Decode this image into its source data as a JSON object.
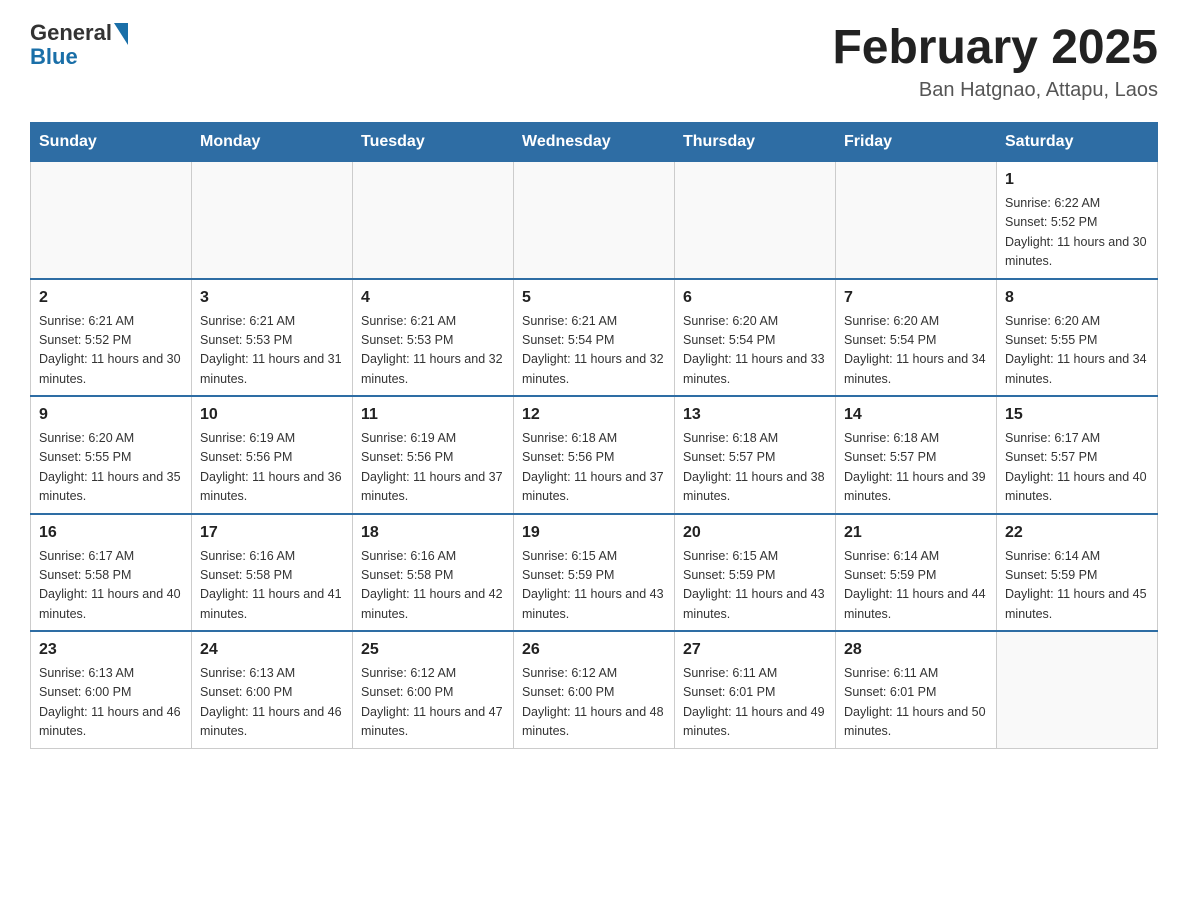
{
  "logo": {
    "general": "General",
    "blue": "Blue"
  },
  "title": "February 2025",
  "subtitle": "Ban Hatgnao, Attapu, Laos",
  "days_of_week": [
    "Sunday",
    "Monday",
    "Tuesday",
    "Wednesday",
    "Thursday",
    "Friday",
    "Saturday"
  ],
  "weeks": [
    [
      {
        "day": "",
        "sunrise": "",
        "sunset": "",
        "daylight": ""
      },
      {
        "day": "",
        "sunrise": "",
        "sunset": "",
        "daylight": ""
      },
      {
        "day": "",
        "sunrise": "",
        "sunset": "",
        "daylight": ""
      },
      {
        "day": "",
        "sunrise": "",
        "sunset": "",
        "daylight": ""
      },
      {
        "day": "",
        "sunrise": "",
        "sunset": "",
        "daylight": ""
      },
      {
        "day": "",
        "sunrise": "",
        "sunset": "",
        "daylight": ""
      },
      {
        "day": "1",
        "sunrise": "Sunrise: 6:22 AM",
        "sunset": "Sunset: 5:52 PM",
        "daylight": "Daylight: 11 hours and 30 minutes."
      }
    ],
    [
      {
        "day": "2",
        "sunrise": "Sunrise: 6:21 AM",
        "sunset": "Sunset: 5:52 PM",
        "daylight": "Daylight: 11 hours and 30 minutes."
      },
      {
        "day": "3",
        "sunrise": "Sunrise: 6:21 AM",
        "sunset": "Sunset: 5:53 PM",
        "daylight": "Daylight: 11 hours and 31 minutes."
      },
      {
        "day": "4",
        "sunrise": "Sunrise: 6:21 AM",
        "sunset": "Sunset: 5:53 PM",
        "daylight": "Daylight: 11 hours and 32 minutes."
      },
      {
        "day": "5",
        "sunrise": "Sunrise: 6:21 AM",
        "sunset": "Sunset: 5:54 PM",
        "daylight": "Daylight: 11 hours and 32 minutes."
      },
      {
        "day": "6",
        "sunrise": "Sunrise: 6:20 AM",
        "sunset": "Sunset: 5:54 PM",
        "daylight": "Daylight: 11 hours and 33 minutes."
      },
      {
        "day": "7",
        "sunrise": "Sunrise: 6:20 AM",
        "sunset": "Sunset: 5:54 PM",
        "daylight": "Daylight: 11 hours and 34 minutes."
      },
      {
        "day": "8",
        "sunrise": "Sunrise: 6:20 AM",
        "sunset": "Sunset: 5:55 PM",
        "daylight": "Daylight: 11 hours and 34 minutes."
      }
    ],
    [
      {
        "day": "9",
        "sunrise": "Sunrise: 6:20 AM",
        "sunset": "Sunset: 5:55 PM",
        "daylight": "Daylight: 11 hours and 35 minutes."
      },
      {
        "day": "10",
        "sunrise": "Sunrise: 6:19 AM",
        "sunset": "Sunset: 5:56 PM",
        "daylight": "Daylight: 11 hours and 36 minutes."
      },
      {
        "day": "11",
        "sunrise": "Sunrise: 6:19 AM",
        "sunset": "Sunset: 5:56 PM",
        "daylight": "Daylight: 11 hours and 37 minutes."
      },
      {
        "day": "12",
        "sunrise": "Sunrise: 6:18 AM",
        "sunset": "Sunset: 5:56 PM",
        "daylight": "Daylight: 11 hours and 37 minutes."
      },
      {
        "day": "13",
        "sunrise": "Sunrise: 6:18 AM",
        "sunset": "Sunset: 5:57 PM",
        "daylight": "Daylight: 11 hours and 38 minutes."
      },
      {
        "day": "14",
        "sunrise": "Sunrise: 6:18 AM",
        "sunset": "Sunset: 5:57 PM",
        "daylight": "Daylight: 11 hours and 39 minutes."
      },
      {
        "day": "15",
        "sunrise": "Sunrise: 6:17 AM",
        "sunset": "Sunset: 5:57 PM",
        "daylight": "Daylight: 11 hours and 40 minutes."
      }
    ],
    [
      {
        "day": "16",
        "sunrise": "Sunrise: 6:17 AM",
        "sunset": "Sunset: 5:58 PM",
        "daylight": "Daylight: 11 hours and 40 minutes."
      },
      {
        "day": "17",
        "sunrise": "Sunrise: 6:16 AM",
        "sunset": "Sunset: 5:58 PM",
        "daylight": "Daylight: 11 hours and 41 minutes."
      },
      {
        "day": "18",
        "sunrise": "Sunrise: 6:16 AM",
        "sunset": "Sunset: 5:58 PM",
        "daylight": "Daylight: 11 hours and 42 minutes."
      },
      {
        "day": "19",
        "sunrise": "Sunrise: 6:15 AM",
        "sunset": "Sunset: 5:59 PM",
        "daylight": "Daylight: 11 hours and 43 minutes."
      },
      {
        "day": "20",
        "sunrise": "Sunrise: 6:15 AM",
        "sunset": "Sunset: 5:59 PM",
        "daylight": "Daylight: 11 hours and 43 minutes."
      },
      {
        "day": "21",
        "sunrise": "Sunrise: 6:14 AM",
        "sunset": "Sunset: 5:59 PM",
        "daylight": "Daylight: 11 hours and 44 minutes."
      },
      {
        "day": "22",
        "sunrise": "Sunrise: 6:14 AM",
        "sunset": "Sunset: 5:59 PM",
        "daylight": "Daylight: 11 hours and 45 minutes."
      }
    ],
    [
      {
        "day": "23",
        "sunrise": "Sunrise: 6:13 AM",
        "sunset": "Sunset: 6:00 PM",
        "daylight": "Daylight: 11 hours and 46 minutes."
      },
      {
        "day": "24",
        "sunrise": "Sunrise: 6:13 AM",
        "sunset": "Sunset: 6:00 PM",
        "daylight": "Daylight: 11 hours and 46 minutes."
      },
      {
        "day": "25",
        "sunrise": "Sunrise: 6:12 AM",
        "sunset": "Sunset: 6:00 PM",
        "daylight": "Daylight: 11 hours and 47 minutes."
      },
      {
        "day": "26",
        "sunrise": "Sunrise: 6:12 AM",
        "sunset": "Sunset: 6:00 PM",
        "daylight": "Daylight: 11 hours and 48 minutes."
      },
      {
        "day": "27",
        "sunrise": "Sunrise: 6:11 AM",
        "sunset": "Sunset: 6:01 PM",
        "daylight": "Daylight: 11 hours and 49 minutes."
      },
      {
        "day": "28",
        "sunrise": "Sunrise: 6:11 AM",
        "sunset": "Sunset: 6:01 PM",
        "daylight": "Daylight: 11 hours and 50 minutes."
      },
      {
        "day": "",
        "sunrise": "",
        "sunset": "",
        "daylight": ""
      }
    ]
  ]
}
